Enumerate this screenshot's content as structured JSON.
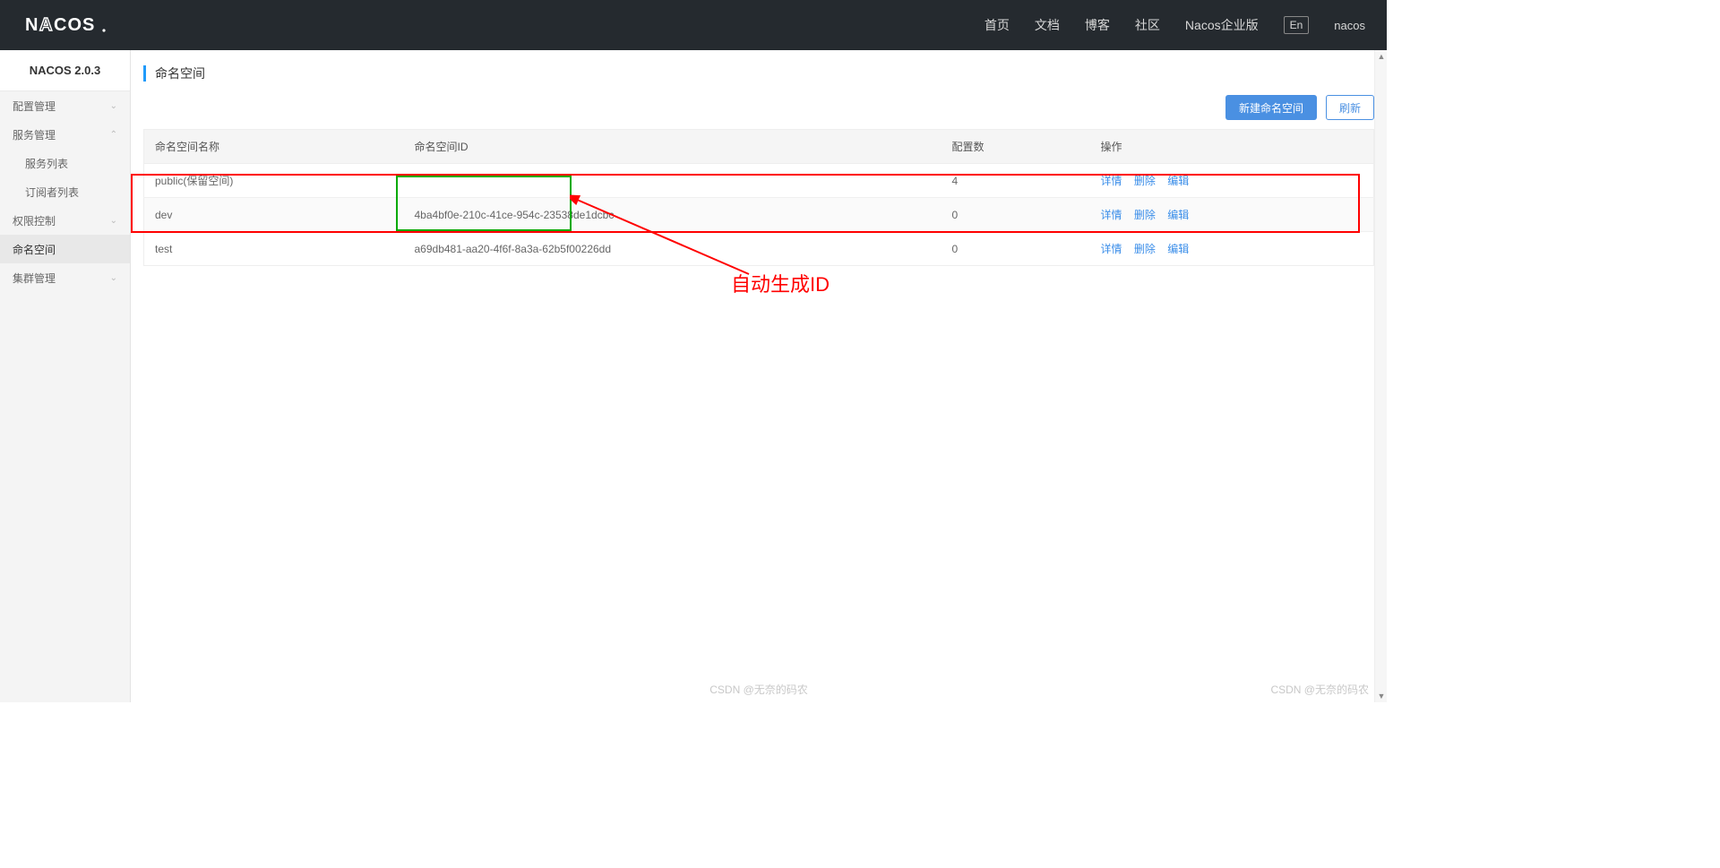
{
  "brand": "NACOS.",
  "topnav": {
    "home": "首页",
    "docs": "文档",
    "blog": "博客",
    "community": "社区",
    "enterprise": "Nacos企业版",
    "lang": "En",
    "user": "nacos"
  },
  "sidebar": {
    "title": "NACOS 2.0.3",
    "items": [
      {
        "label": "配置管理",
        "expandable": true,
        "open": false
      },
      {
        "label": "服务管理",
        "expandable": true,
        "open": true,
        "children": [
          {
            "label": "服务列表"
          },
          {
            "label": "订阅者列表"
          }
        ]
      },
      {
        "label": "权限控制",
        "expandable": true,
        "open": false
      },
      {
        "label": "命名空间",
        "expandable": false,
        "active": true
      },
      {
        "label": "集群管理",
        "expandable": true,
        "open": false
      }
    ]
  },
  "page": {
    "title": "命名空间",
    "create_btn": "新建命名空间",
    "refresh_btn": "刷新"
  },
  "table": {
    "headers": {
      "name": "命名空间名称",
      "id": "命名空间ID",
      "count": "配置数",
      "action": "操作"
    },
    "action_labels": {
      "detail": "详情",
      "delete": "删除",
      "edit": "编辑"
    },
    "rows": [
      {
        "name": "public(保留空间)",
        "id": "",
        "count": "4"
      },
      {
        "name": "dev",
        "id": "4ba4bf0e-210c-41ce-954c-23538de1dcbc",
        "count": "0"
      },
      {
        "name": "test",
        "id": "a69db481-aa20-4f6f-8a3a-62b5f00226dd",
        "count": "0"
      }
    ]
  },
  "annotation": {
    "label": "自动生成ID"
  },
  "watermark_left": "CSDN @无奈的码农",
  "watermark_right": "CSDN @无奈的码农"
}
